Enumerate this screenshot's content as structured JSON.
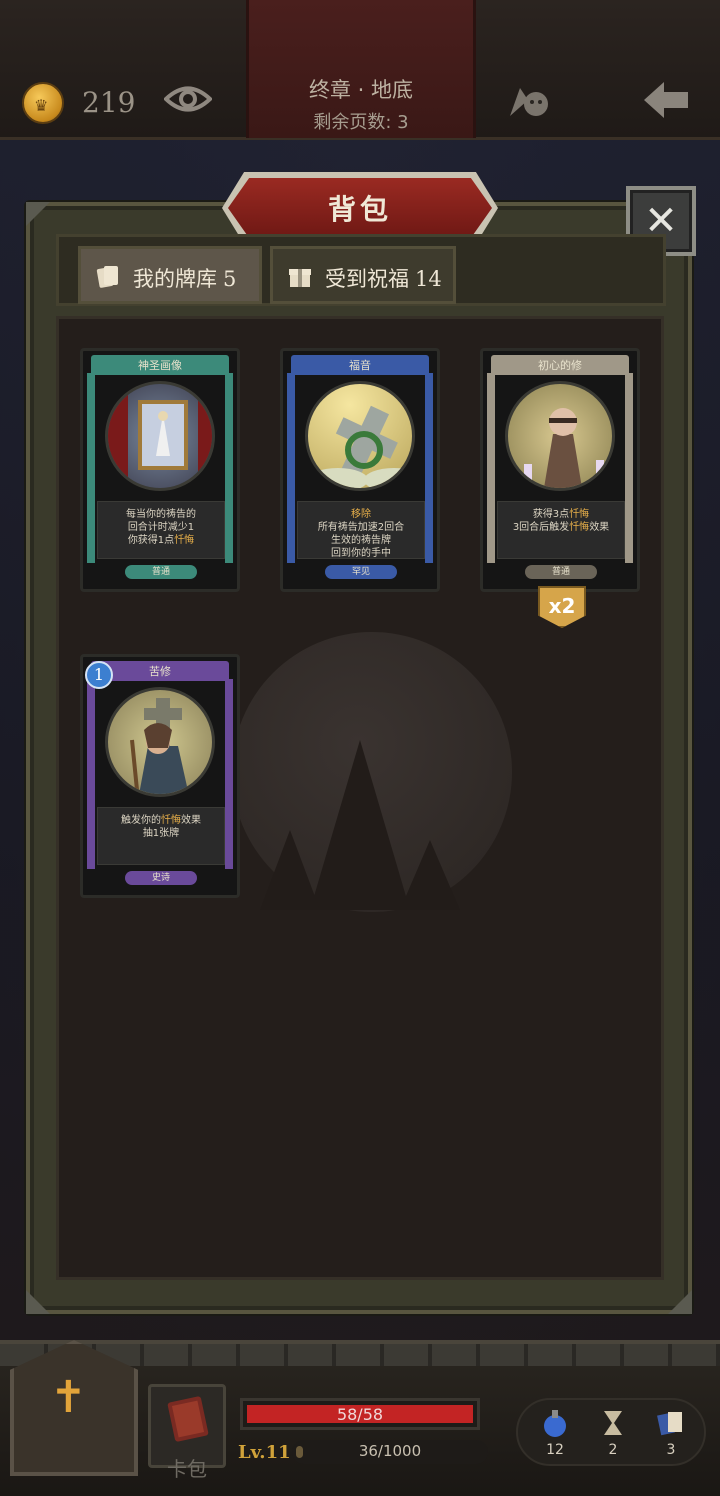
{
  "topbar": {
    "coin_count": "219",
    "chapter_title": "终章 · 地底",
    "pages_left": "剩余页数: 3"
  },
  "modal": {
    "title": "背包",
    "close_label": "✕"
  },
  "tabs": [
    {
      "label": "我的牌库",
      "count": "5"
    },
    {
      "label": "受到祝福",
      "count": "14"
    }
  ],
  "cards": [
    {
      "name": "神圣画像",
      "desc_lines": [
        "每当你的祷告的",
        "回合计时减少1",
        "你获得1点忏悔"
      ],
      "rarity": "普通",
      "color": "#3c8a7a"
    },
    {
      "name": "福音",
      "desc_lines": [
        "移除",
        "所有祷告加速2回合",
        "生效的祷告牌",
        "回到你的手中"
      ],
      "rarity": "罕见",
      "color": "#3a5aa6"
    },
    {
      "name": "初心的修",
      "desc_lines": [
        "获得3点忏悔",
        "3回合后触发忏悔效果"
      ],
      "rarity": "普通",
      "color": "#a09888",
      "multiplier": "x2"
    },
    {
      "name": "苦修",
      "desc_lines": [
        "触发你的忏悔效果",
        "抽1张牌"
      ],
      "rarity": "史诗",
      "color": "#6a4a9a",
      "level": "1"
    }
  ],
  "hud": {
    "hp": "58/58",
    "hp_fraction": 1.0,
    "level": "Lv.11",
    "xp": "36/1000",
    "xp_fraction": 0.036,
    "card_pack_label": "卡包",
    "resources": [
      "12",
      "2",
      "3"
    ]
  }
}
